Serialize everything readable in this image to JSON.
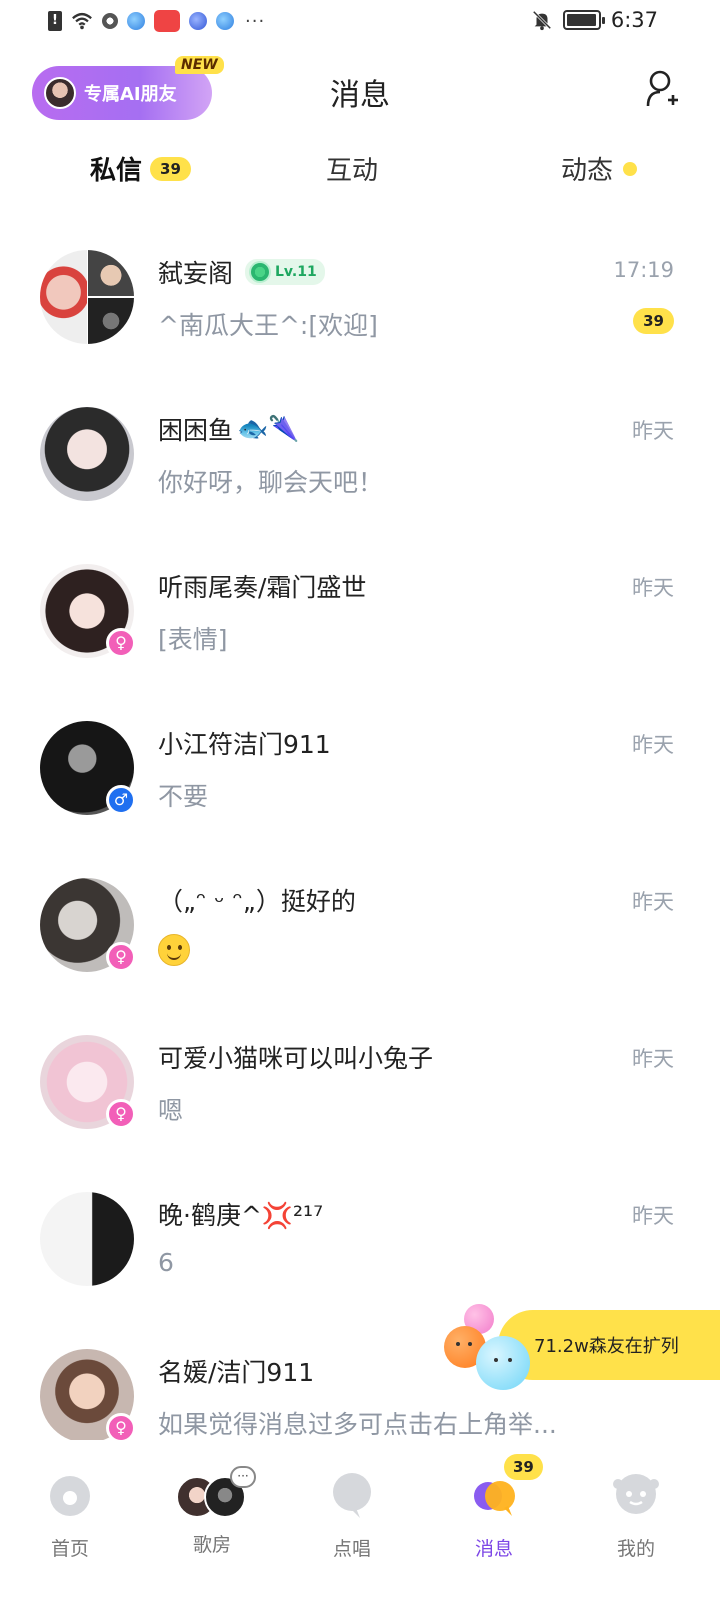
{
  "status_bar": {
    "time": "6:37",
    "overflow_dots": "···"
  },
  "header": {
    "ai_friend_label": "专属AI朋友",
    "new_badge": "NEW",
    "title": "消息",
    "add_friend_icon": "add-person-icon"
  },
  "tabs": [
    {
      "label": "私信",
      "badge": "39",
      "active": true
    },
    {
      "label": "互动"
    },
    {
      "label": "动态",
      "dot": true
    }
  ],
  "conversations": [
    {
      "name": "弑妄阁",
      "level": "Lv.11",
      "preview": "^南瓜大王^:[欢迎]",
      "time": "17:19",
      "unread": "39"
    },
    {
      "name": "困困鱼",
      "name_emoji": "🐟🌂",
      "preview": "你好呀，聊会天吧！",
      "time": "昨天"
    },
    {
      "name": "听雨尾奏/霜门盛世",
      "preview": "[表情]",
      "time": "昨天",
      "gender": "♀"
    },
    {
      "name": "小江符洁门911",
      "preview": "不要",
      "time": "昨天",
      "gender": "♂"
    },
    {
      "name": "（„ᵔ ᵕ ᵔ„）挺好的",
      "preview": "🙂",
      "time": "昨天",
      "gender": "♀"
    },
    {
      "name": "可爱小猫咪可以叫小兔子",
      "preview": "嗯",
      "time": "昨天",
      "gender": "♀"
    },
    {
      "name": "晚·鹤庚^💢²¹⁷",
      "preview": "6",
      "time": "昨天"
    },
    {
      "name": "名媛/洁门911",
      "preview": "如果觉得消息过多可点击右上角举...",
      "time": "",
      "gender": "♀"
    }
  ],
  "promo": {
    "text": "71.2w森友在扩列"
  },
  "bottom_nav": {
    "items": [
      {
        "label": "首页"
      },
      {
        "label": "歌房",
        "more": "···"
      },
      {
        "label": "点唱"
      },
      {
        "label": "消息",
        "badge": "39",
        "active": true
      },
      {
        "label": "我的"
      }
    ]
  },
  "colors": {
    "accent_yellow": "#ffe14a",
    "accent_purple": "#7d47e6",
    "female": "#f25fb8",
    "male": "#1f6ff0"
  }
}
